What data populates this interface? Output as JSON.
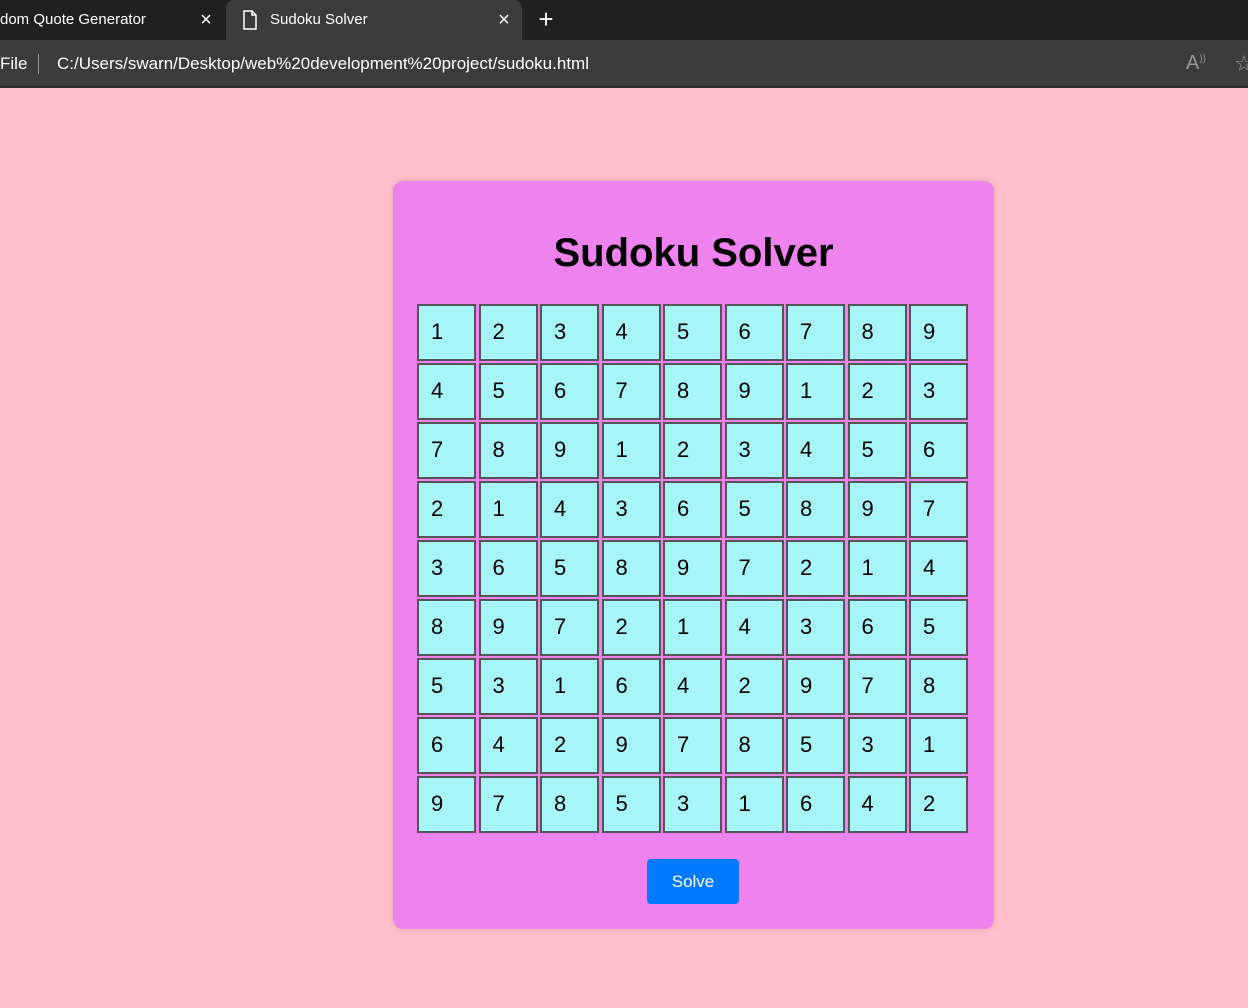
{
  "browser": {
    "tabs": [
      {
        "label": "dom Quote Generator",
        "active": false
      },
      {
        "label": "Sudoku Solver",
        "active": true
      }
    ],
    "close_icon": "×",
    "new_tab_icon": "+",
    "address": {
      "scheme_label": "File",
      "url": "C:/Users/swarn/Desktop/web%20development%20project/sudoku.html"
    }
  },
  "page": {
    "title": "Sudoku Solver",
    "solve_label": "Solve",
    "colors": {
      "background": "#ffc0cb",
      "card": "#ee82ee",
      "cell": "#a6f6f8",
      "button": "#007bff"
    },
    "grid": [
      [
        "1",
        "2",
        "3",
        "4",
        "5",
        "6",
        "7",
        "8",
        "9"
      ],
      [
        "4",
        "5",
        "6",
        "7",
        "8",
        "9",
        "1",
        "2",
        "3"
      ],
      [
        "7",
        "8",
        "9",
        "1",
        "2",
        "3",
        "4",
        "5",
        "6"
      ],
      [
        "2",
        "1",
        "4",
        "3",
        "6",
        "5",
        "8",
        "9",
        "7"
      ],
      [
        "3",
        "6",
        "5",
        "8",
        "9",
        "7",
        "2",
        "1",
        "4"
      ],
      [
        "8",
        "9",
        "7",
        "2",
        "1",
        "4",
        "3",
        "6",
        "5"
      ],
      [
        "5",
        "3",
        "1",
        "6",
        "4",
        "2",
        "9",
        "7",
        "8"
      ],
      [
        "6",
        "4",
        "2",
        "9",
        "7",
        "8",
        "5",
        "3",
        "1"
      ],
      [
        "9",
        "7",
        "8",
        "5",
        "3",
        "1",
        "6",
        "4",
        "2"
      ]
    ]
  }
}
